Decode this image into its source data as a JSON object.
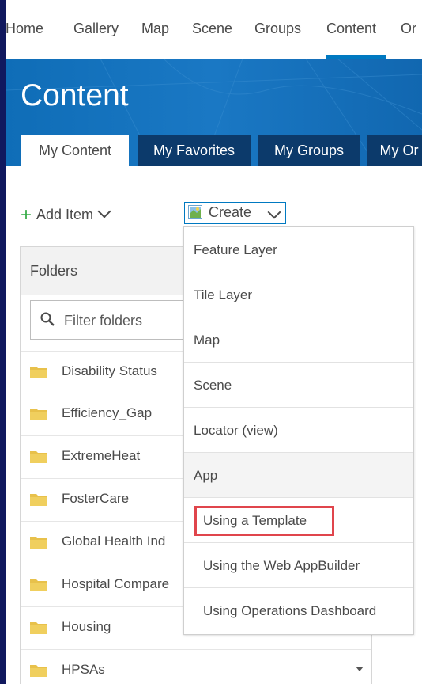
{
  "nav": {
    "items": [
      "Home",
      "Gallery",
      "Map",
      "Scene",
      "Groups",
      "Content",
      "Or"
    ],
    "active": "Content"
  },
  "banner": {
    "title": "Content",
    "tabs": [
      "My Content",
      "My Favorites",
      "My Groups",
      "My Or"
    ]
  },
  "toolbar": {
    "add_item_label": "Add Item",
    "create_label": "Create"
  },
  "folders": {
    "header": "Folders",
    "filter_placeholder": "Filter folders",
    "items": [
      "Disability Status",
      "Efficiency_Gap",
      "ExtremeHeat",
      "FosterCare",
      "Global Health Ind",
      "Hospital Compare",
      "Housing",
      "HPSAs"
    ]
  },
  "create_menu": {
    "items": [
      "Feature Layer",
      "Tile Layer",
      "Map",
      "Scene",
      "Locator (view)"
    ],
    "app_group": "App",
    "app_items": [
      "Using a Template",
      "Using the Web AppBuilder",
      "Using Operations Dashboard"
    ],
    "highlighted": "Using a Template"
  },
  "colors": {
    "accent": "#0079c1",
    "plus_green": "#35ac46",
    "folder_yellow": "#e8c14b",
    "highlight_red": "#e0454c",
    "outer_frame": "#10185e"
  }
}
